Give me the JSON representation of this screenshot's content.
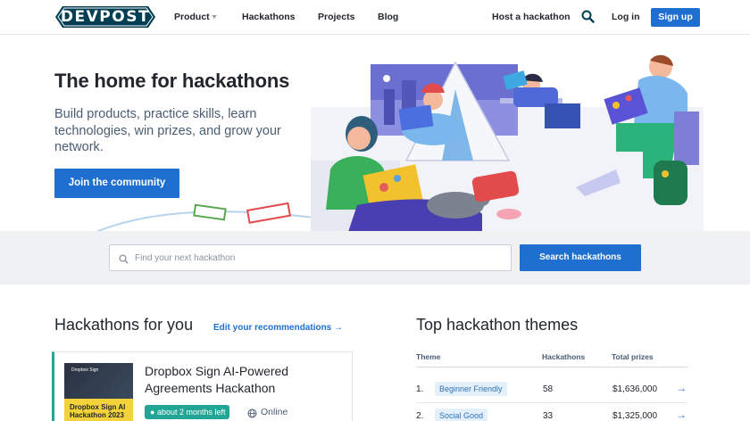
{
  "nav": {
    "logo": "DEVPOST",
    "items": [
      {
        "label": "Product"
      },
      {
        "label": "Hackathons"
      },
      {
        "label": "Projects"
      },
      {
        "label": "Blog"
      }
    ],
    "host_label": "Host a hackathon",
    "login_label": "Log in",
    "signup_label": "Sign up"
  },
  "hero": {
    "title": "The home for hackathons",
    "subtitle": "Build products, practice skills, learn technologies, win prizes, and grow your network.",
    "cta_label": "Join the community"
  },
  "search": {
    "placeholder": "Find your next hackathon",
    "button_label": "Search hackathons"
  },
  "hackathons_for_you": {
    "title": "Hackathons for you",
    "edit_label": "Edit your recommendations",
    "cards": [
      {
        "title": "Dropbox Sign AI-Powered Agreements Hackathon",
        "thumb_brand": "Dropbox Sign",
        "thumb_text": "Dropbox Sign AI Hackathon 2023",
        "time_left": "about 2 months left",
        "location": "Online"
      }
    ]
  },
  "top_themes": {
    "title": "Top hackathon themes",
    "columns": [
      "Theme",
      "Hackathons",
      "Total prizes"
    ],
    "rows": [
      {
        "rank": "1.",
        "theme": "Beginner Friendly",
        "hackathons": "58",
        "prizes": "$1,636,000"
      },
      {
        "rank": "2.",
        "theme": "Social Good",
        "hackathons": "33",
        "prizes": "$1,325,000"
      }
    ]
  },
  "colors": {
    "brand_dark": "#003e54",
    "primary": "#1f6fd1",
    "teal": "#21a595"
  },
  "icons": [
    "search-icon",
    "arrow-right-icon",
    "globe-icon",
    "chevron-down-icon"
  ]
}
